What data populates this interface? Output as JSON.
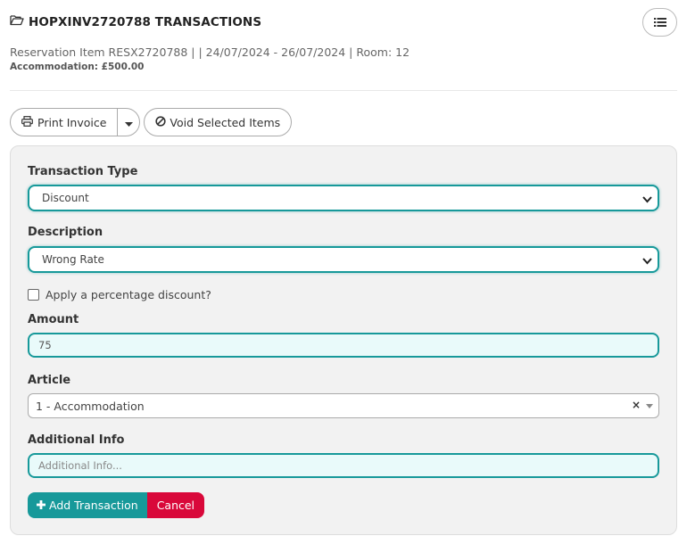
{
  "header": {
    "title": "HOPXINV2720788 TRANSACTIONS",
    "icon": "folder-open-icon",
    "menu_icon": "list-icon"
  },
  "reservation": {
    "summary": "Reservation Item RESX2720788 | | 24/07/2024 - 26/07/2024 | Room: 12",
    "accommodation": "Accommodation: £500.00"
  },
  "toolbar": {
    "print_label": "Print Invoice",
    "void_label": "Void Selected Items"
  },
  "form": {
    "transaction_type": {
      "label": "Transaction Type",
      "value": "Discount"
    },
    "description": {
      "label": "Description",
      "value": "Wrong Rate"
    },
    "percentage": {
      "label": "Apply a percentage discount?",
      "checked": false
    },
    "amount": {
      "label": "Amount",
      "value": "75"
    },
    "article": {
      "label": "Article",
      "value": "1 - Accommodation",
      "clear": "×"
    },
    "additional_info": {
      "label": "Additional Info",
      "placeholder": "Additional Info..."
    }
  },
  "actions": {
    "add_label": "Add Transaction",
    "cancel_label": "Cancel"
  },
  "colors": {
    "accent": "#17999a",
    "danger": "#d9083a"
  }
}
